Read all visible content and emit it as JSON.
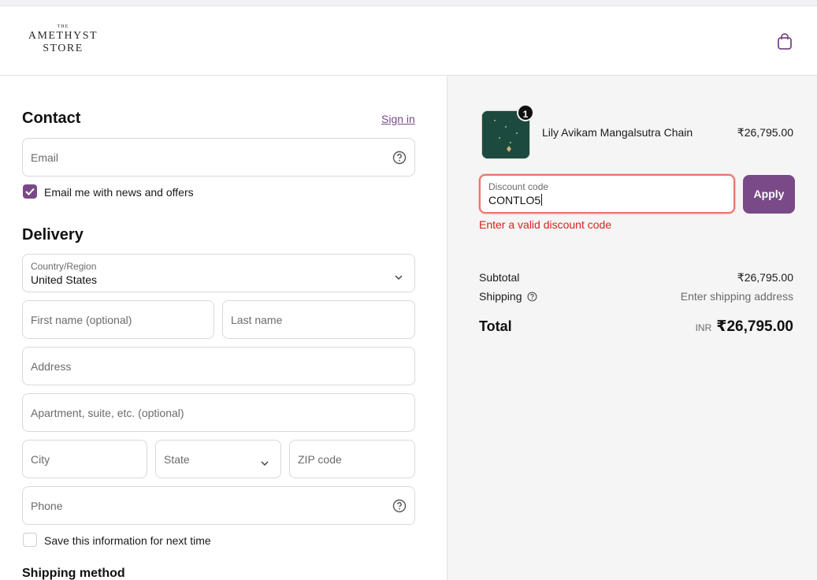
{
  "brand": {
    "line_the": "THE",
    "line1": "AMETHYST",
    "line2": "STORE"
  },
  "colors": {
    "accent": "#7a4a88",
    "error": "#d4251b",
    "error_border": "#e9776e"
  },
  "icons": {
    "cart": "shopping-bag-icon",
    "help": "question-circle-icon",
    "dropdown": "chevron-down-icon",
    "check": "checkmark-icon"
  },
  "contact": {
    "heading": "Contact",
    "sign_in": "Sign in",
    "email_placeholder": "Email",
    "newsletter_label": "Email me with news and offers",
    "newsletter_checked": true
  },
  "delivery": {
    "heading": "Delivery",
    "country_label": "Country/Region",
    "country_value": "United States",
    "first_name_placeholder": "First name (optional)",
    "last_name_placeholder": "Last name",
    "address_placeholder": "Address",
    "apartment_placeholder": "Apartment, suite, etc. (optional)",
    "city_placeholder": "City",
    "state_placeholder": "State",
    "zip_placeholder": "ZIP code",
    "phone_placeholder": "Phone",
    "save_info_label": "Save this information for next time",
    "save_info_checked": false
  },
  "shipping_method": {
    "heading": "Shipping method"
  },
  "summary": {
    "item": {
      "name": "Lily Avikam Mangalsutra Chain",
      "price": "₹26,795.00",
      "quantity": "1"
    },
    "discount": {
      "label": "Discount code",
      "value": "CONTLO5",
      "apply_label": "Apply",
      "error": "Enter a valid discount code"
    },
    "subtotal_label": "Subtotal",
    "subtotal_value": "₹26,795.00",
    "shipping_label": "Shipping",
    "shipping_value": "Enter shipping address",
    "total_label": "Total",
    "total_currency": "INR",
    "total_value": "₹26,795.00"
  }
}
